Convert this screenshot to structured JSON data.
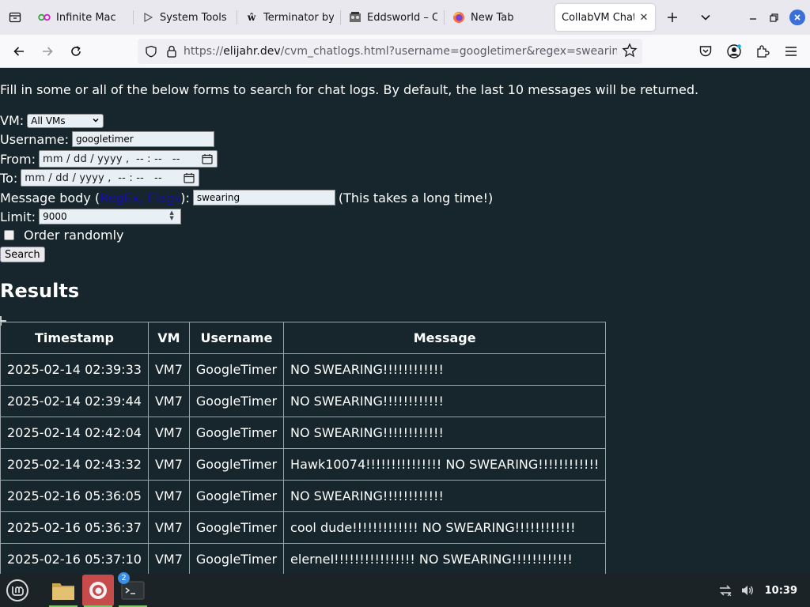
{
  "browser": {
    "tabs": [
      {
        "label": "Infinite Mac",
        "icon": "infinite-mac-icon",
        "active": false
      },
      {
        "label": "System Tools •",
        "icon": "play-icon",
        "active": false
      },
      {
        "label": "Terminator by",
        "icon": "wikipedia-icon",
        "active": false
      },
      {
        "label": "Eddsworld – C",
        "icon": "eddsworld-icon",
        "active": false
      },
      {
        "label": "New Tab",
        "icon": "firefox-icon",
        "active": false
      },
      {
        "label": "CollabVM Chat L",
        "icon": "",
        "active": true
      }
    ],
    "url_prefix": "https://",
    "url_host": "elijahr.dev",
    "url_rest": "/cvm_chatlogs.html?username=googletimer&regex=swearing&count"
  },
  "page": {
    "intro": "Fill in some or all of the below forms to search for chat logs. By default, the last 10 messages will be returned.",
    "vm_label": "VM:",
    "vm_selected": "All VMs",
    "username_label": "Username:",
    "username_value": "googletimer",
    "from_label": "From:",
    "from_value": "mm / dd / yyyy ,  -- : --   --",
    "to_label": "To:",
    "to_value": "mm / dd / yyyy ,  -- : --   --",
    "message_label_pre": "Message body (",
    "message_link": "RegEx, Flags",
    "message_label_post": "):",
    "message_value": "swearing",
    "message_note": "(This takes a long time!)",
    "limit_label": "Limit:",
    "limit_value": "9000",
    "order_label": "Order randomly",
    "search_button": "Search",
    "results_heading": "Results",
    "table": {
      "headers": [
        "Timestamp",
        "VM",
        "Username",
        "Message"
      ],
      "rows": [
        [
          "2025-02-14 02:39:33",
          "VM7",
          "GoogleTimer",
          "NO SWEARING!!!!!!!!!!!!"
        ],
        [
          "2025-02-14 02:39:44",
          "VM7",
          "GoogleTimer",
          "NO SWEARING!!!!!!!!!!!!"
        ],
        [
          "2025-02-14 02:42:04",
          "VM7",
          "GoogleTimer",
          "NO SWEARING!!!!!!!!!!!!"
        ],
        [
          "2025-02-14 02:43:32",
          "VM7",
          "GoogleTimer",
          "Hawk10074!!!!!!!!!!!!!!! NO SWEARING!!!!!!!!!!!!"
        ],
        [
          "2025-02-16 05:36:05",
          "VM7",
          "GoogleTimer",
          "NO SWEARING!!!!!!!!!!!!"
        ],
        [
          "2025-02-16 05:36:37",
          "VM7",
          "GoogleTimer",
          "cool dude!!!!!!!!!!!!! NO SWEARING!!!!!!!!!!!!"
        ],
        [
          "2025-02-16 05:37:10",
          "VM7",
          "GoogleTimer",
          "elerneI!!!!!!!!!!!!!!!! NO SWEARING!!!!!!!!!!!!"
        ]
      ]
    }
  },
  "taskbar": {
    "terminal_badge": "2",
    "clock": "10:39"
  }
}
